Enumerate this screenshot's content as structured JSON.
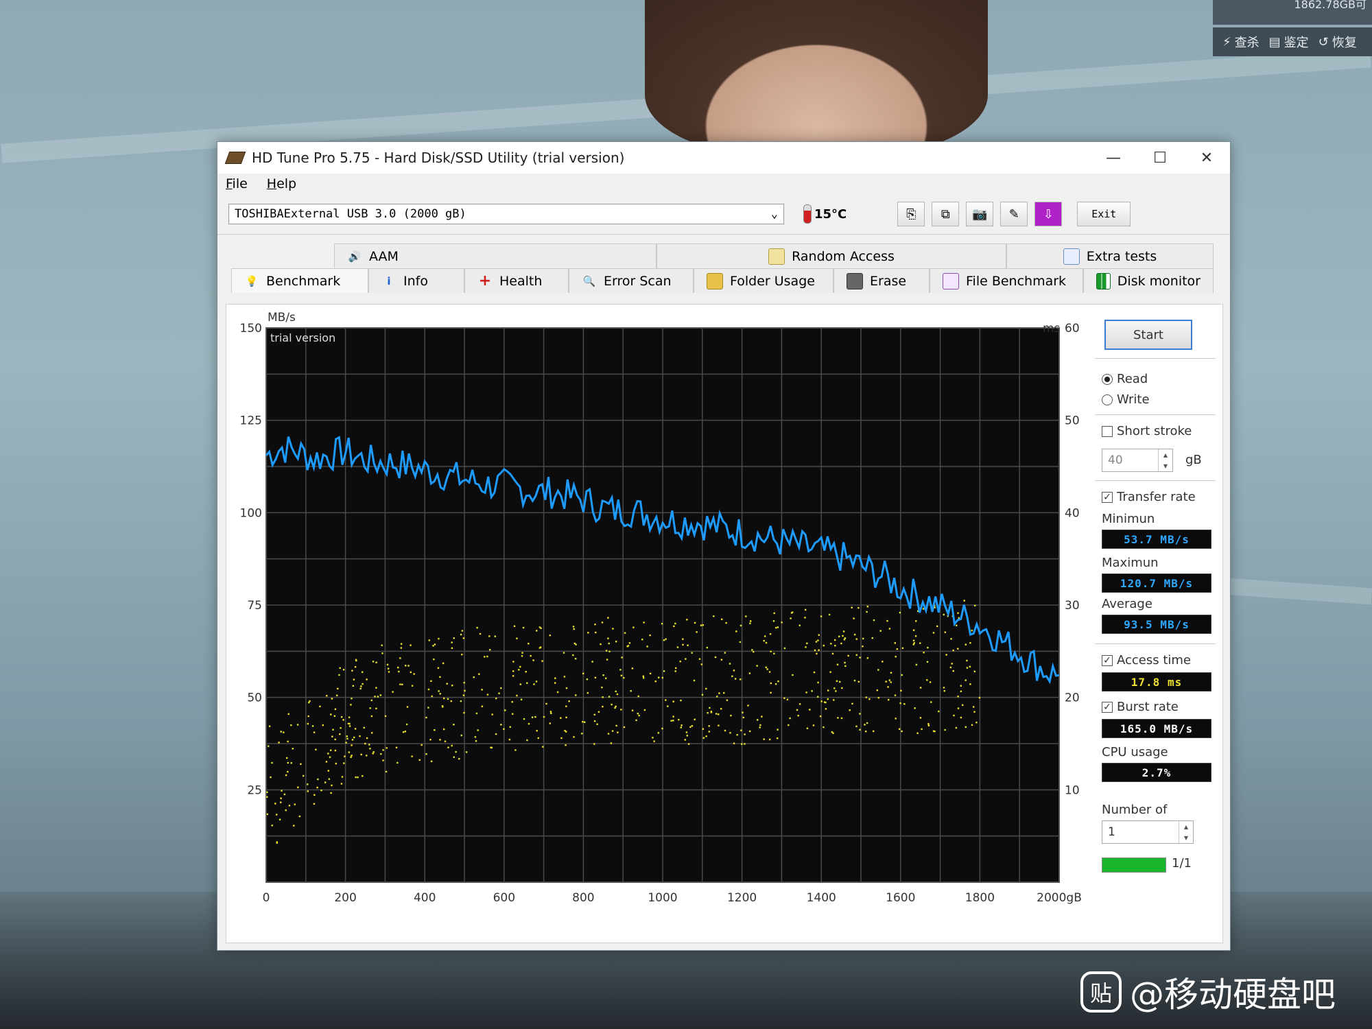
{
  "desktop": {
    "tray_top_text": "1862.78GB可",
    "tray_items": [
      {
        "icon": "lightning-icon",
        "label": "查杀"
      },
      {
        "icon": "disk-icon",
        "label": "鉴定"
      },
      {
        "icon": "restore-icon",
        "label": "恢复"
      }
    ],
    "watermark": "@移动硬盘吧",
    "watermark_logo": "贴"
  },
  "window": {
    "title": "HD Tune Pro 5.75 - Hard Disk/SSD Utility (trial version)",
    "minimize": "—",
    "maximize": "☐",
    "close": "✕"
  },
  "menu": {
    "file": "File",
    "help": "Help"
  },
  "toolbar": {
    "drive": "TOSHIBAExternal USB 3.0 (2000 gB)",
    "temperature": "15°C",
    "exit_label": "Exit"
  },
  "tabs": {
    "top": [
      {
        "label": "AAM",
        "icon": "speaker-icon"
      },
      {
        "label": "Random Access",
        "icon": "grid-icon"
      },
      {
        "label": "Extra tests",
        "icon": "window-icon"
      }
    ],
    "bottom": [
      {
        "label": "Benchmark",
        "icon": "bulb-icon",
        "active": true
      },
      {
        "label": "Info",
        "icon": "info-icon"
      },
      {
        "label": "Health",
        "icon": "health-cross-icon"
      },
      {
        "label": "Error Scan",
        "icon": "magnifier-icon"
      },
      {
        "label": "Folder Usage",
        "icon": "folder-icon"
      },
      {
        "label": "Erase",
        "icon": "trash-icon"
      },
      {
        "label": "File Benchmark",
        "icon": "file-bench-icon"
      },
      {
        "label": "Disk monitor",
        "icon": "bar-chart-icon"
      }
    ]
  },
  "side": {
    "start": "Start",
    "read": "Read",
    "write": "Write",
    "short_stroke": "Short stroke",
    "short_stroke_value": "40",
    "short_stroke_unit": "gB",
    "transfer_rate": "Transfer rate",
    "minimum_label": "Minimun",
    "minimum_value": "53.7 MB/s",
    "maximum_label": "Maximun",
    "maximum_value": "120.7 MB/s",
    "average_label": "Average",
    "average_value": "93.5 MB/s",
    "access_time": "Access time",
    "access_time_value": "17.8 ms",
    "burst_rate": "Burst rate",
    "burst_rate_value": "165.0 MB/s",
    "cpu_usage": "CPU usage",
    "cpu_usage_value": "2.7%",
    "number_of": "Number of",
    "number_of_value": "1",
    "progress_text": "1/1",
    "progress_fraction": 1.0,
    "lcd_colors": {
      "rate": "#2fa8ff",
      "access": "#f0e030",
      "plain": "#ffffff"
    }
  },
  "chart_data": {
    "type": "line",
    "watermark": "trial version",
    "y_left_unit": "MB/s",
    "y_right_unit": "ms",
    "x_unit": "gB",
    "xlim": [
      0,
      2000
    ],
    "ylim_left": [
      0,
      150
    ],
    "ylim_right": [
      0,
      60
    ],
    "x_ticks": [
      "0",
      "200",
      "400",
      "600",
      "800",
      "1000",
      "1200",
      "1400",
      "1600",
      "1800",
      "2000gB"
    ],
    "y_left_ticks": [
      "150",
      "125",
      "100",
      "75",
      "50",
      "25"
    ],
    "y_right_ticks": [
      "60",
      "50",
      "40",
      "30",
      "20",
      "10"
    ],
    "grid": true,
    "series": [
      {
        "kind": "line",
        "color": "#1e9bff",
        "x": [
          0,
          40,
          80,
          120,
          160,
          200,
          240,
          280,
          320,
          360,
          400,
          440,
          480,
          520,
          560,
          600,
          640,
          680,
          720,
          760,
          800,
          840,
          880,
          920,
          960,
          1000,
          1040,
          1080,
          1120,
          1160,
          1200,
          1240,
          1280,
          1320,
          1360,
          1400,
          1440,
          1480,
          1520,
          1560,
          1600,
          1640,
          1680,
          1720,
          1760,
          1800,
          1840,
          1880,
          1920,
          1960,
          2000
        ],
        "y": [
          116,
          118,
          117,
          115,
          116,
          117,
          115,
          114,
          114,
          113,
          112,
          111,
          110,
          109,
          108,
          108,
          107,
          106,
          106,
          105,
          104,
          102,
          101,
          101,
          100,
          99,
          98,
          98,
          97,
          96,
          95,
          94,
          93,
          92,
          91,
          90,
          89,
          87,
          85,
          83,
          80,
          78,
          76,
          74,
          72,
          70,
          67,
          64,
          61,
          58,
          56
        ]
      },
      {
        "kind": "scatter",
        "color": "#e8e030",
        "trend_x": [
          0,
          200,
          400,
          600,
          800,
          1000,
          1200,
          1400,
          1600,
          1800
        ],
        "trend_y": [
          10,
          18,
          20,
          21,
          22,
          22,
          22,
          23,
          23,
          24
        ]
      }
    ]
  }
}
